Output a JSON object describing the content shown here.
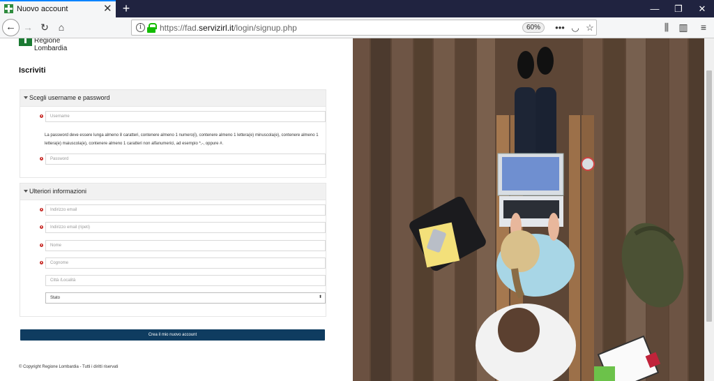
{
  "browser": {
    "tab_title": "Nuovo account",
    "url_prefix": "https://fad.",
    "url_domain": "servizirl.it",
    "url_path": "/login/signup.php",
    "zoom": "60%"
  },
  "logo": {
    "line1": "Regione",
    "line2": "Lombardia"
  },
  "page_title": "Iscriviti",
  "section1": {
    "title": "Scegli username e password",
    "username_placeholder": "Username",
    "password_hint": "La password deve essere lunga almeno 8 caratteri, contenere almeno 1 numero(i), contenere almeno 1 lettera(e) minuscola(e), contenere almeno 1 lettera(e) maiuscola(e), contenere almeno 1 caratteri non alfanumerici, ad esempio *,-, oppure #.",
    "password_placeholder": "Password"
  },
  "section2": {
    "title": "Ulteriori informazioni",
    "email_placeholder": "Indirizzo email",
    "email_repeat_placeholder": "Indirizzo email (ripeti)",
    "name_placeholder": "Nome",
    "surname_placeholder": "Cognome",
    "city_placeholder": "Città /Località",
    "country_selected": "Stato"
  },
  "submit_label": "Crea il mio nuovo account",
  "copyright": "© Copyright Regione Lombardia - Tutti i diritti riservati",
  "colors": {
    "accent": "#0f3c60",
    "required": "#c9302c",
    "brand_green": "#1b7a33"
  }
}
